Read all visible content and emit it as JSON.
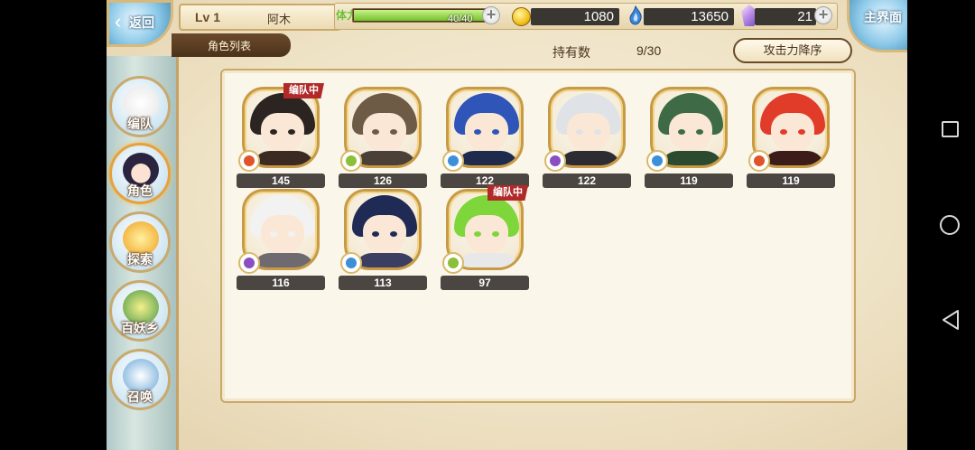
{
  "header": {
    "back_label": "返回",
    "level": "Lv 1",
    "player_name": "阿木",
    "sub_tab": "角色列表",
    "stamina_label": "体力",
    "stamina_value": "40/40",
    "stamina_fraction": 1.0,
    "gold": "1080",
    "soul": "13650",
    "gems": "21",
    "main_menu_label": "主界面"
  },
  "list_header": {
    "count_label": "持有数",
    "count_value": "9/30",
    "sort_label": "攻击力降序"
  },
  "side_menu": [
    {
      "label": "编队"
    },
    {
      "label": "角色"
    },
    {
      "label": "探索"
    },
    {
      "label": "百妖乡"
    },
    {
      "label": "召唤"
    }
  ],
  "characters": [
    {
      "power": "145",
      "tag": "编队中",
      "element": "fire",
      "hair": "#2b2420",
      "body": "#3a2a22"
    },
    {
      "power": "126",
      "tag": "",
      "element": "wind",
      "hair": "#6d5b45",
      "body": "#4a4038"
    },
    {
      "power": "122",
      "tag": "",
      "element": "water",
      "hair": "#2f55b8",
      "body": "#1e2b4c"
    },
    {
      "power": "122",
      "tag": "",
      "element": "dark",
      "hair": "#dfe2e6",
      "body": "#2e2c33"
    },
    {
      "power": "119",
      "tag": "",
      "element": "water",
      "hair": "#3e6b45",
      "body": "#2b4a30"
    },
    {
      "power": "119",
      "tag": "",
      "element": "fire",
      "hair": "#e13b2a",
      "body": "#3b1c18"
    },
    {
      "power": "116",
      "tag": "",
      "element": "dark",
      "hair": "#f2f2f2",
      "body": "#6e6a70"
    },
    {
      "power": "113",
      "tag": "",
      "element": "water",
      "hair": "#1f2b55",
      "body": "#3b3e60"
    },
    {
      "power": "97",
      "tag": "编队中",
      "element": "wind",
      "hair": "#7ed63a",
      "body": "#e8e8e8"
    }
  ],
  "colors": {
    "fire": "#e0542a",
    "wind": "#8cbf3a",
    "water": "#3d8fd8",
    "dark": "#8a4fc0"
  }
}
